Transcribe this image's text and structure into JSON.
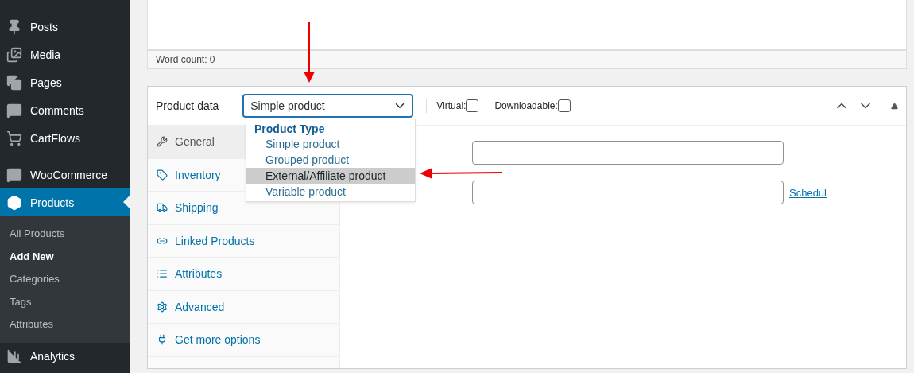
{
  "sidebar": {
    "items": [
      {
        "label": "Posts",
        "selected": false
      },
      {
        "label": "Media",
        "selected": false
      },
      {
        "label": "Pages",
        "selected": false
      },
      {
        "label": "Comments",
        "selected": false
      },
      {
        "label": "CartFlows",
        "selected": false
      },
      {
        "label": "WooCommerce",
        "selected": false
      },
      {
        "label": "Products",
        "selected": true,
        "children": [
          {
            "label": "All Products",
            "selected": false
          },
          {
            "label": "Add New",
            "selected": true
          },
          {
            "label": "Categories",
            "selected": false
          },
          {
            "label": "Tags",
            "selected": false
          },
          {
            "label": "Attributes",
            "selected": false
          }
        ]
      },
      {
        "label": "Analytics",
        "selected": false
      }
    ]
  },
  "editor": {
    "word_count": "Word count: 0"
  },
  "product_data": {
    "title": "Product data —",
    "select": {
      "value": "Simple product",
      "expanded": true,
      "group": "Product Type",
      "options": [
        {
          "label": "Simple product",
          "highlighted": false
        },
        {
          "label": "Grouped product",
          "highlighted": false
        },
        {
          "label": "External/Affiliate product",
          "highlighted": true
        },
        {
          "label": "Variable product",
          "highlighted": false
        }
      ]
    },
    "checkboxes": [
      {
        "label": "Virtual:",
        "checked": false
      },
      {
        "label": "Downloadable:",
        "checked": false
      }
    ],
    "tabs": [
      {
        "label": "General",
        "selected": true
      },
      {
        "label": "Inventory",
        "selected": false
      },
      {
        "label": "Shipping",
        "selected": false
      },
      {
        "label": "Linked Products",
        "selected": false
      },
      {
        "label": "Attributes",
        "selected": false
      },
      {
        "label": "Advanced",
        "selected": false
      },
      {
        "label": "Get more options",
        "selected": false
      }
    ],
    "schedule_link": "Schedul"
  }
}
